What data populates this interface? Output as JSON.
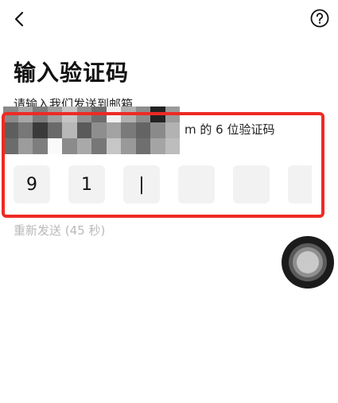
{
  "header": {
    "back_icon": "chevron-left-icon",
    "help_icon": "question-circle-icon"
  },
  "page": {
    "title": "输入验证码",
    "subtitle": "请输入我们发送到邮箱",
    "subtitle_suffix": "m 的 6 位验证码"
  },
  "code_input": {
    "digits": [
      "9",
      "1",
      "|",
      "",
      "",
      ""
    ]
  },
  "resend": {
    "label": "重新发送 (45 秒)"
  },
  "colors": {
    "highlight": "#ee2a24",
    "input_background": "#f2f2f2",
    "muted_text": "#b9b9b9"
  }
}
